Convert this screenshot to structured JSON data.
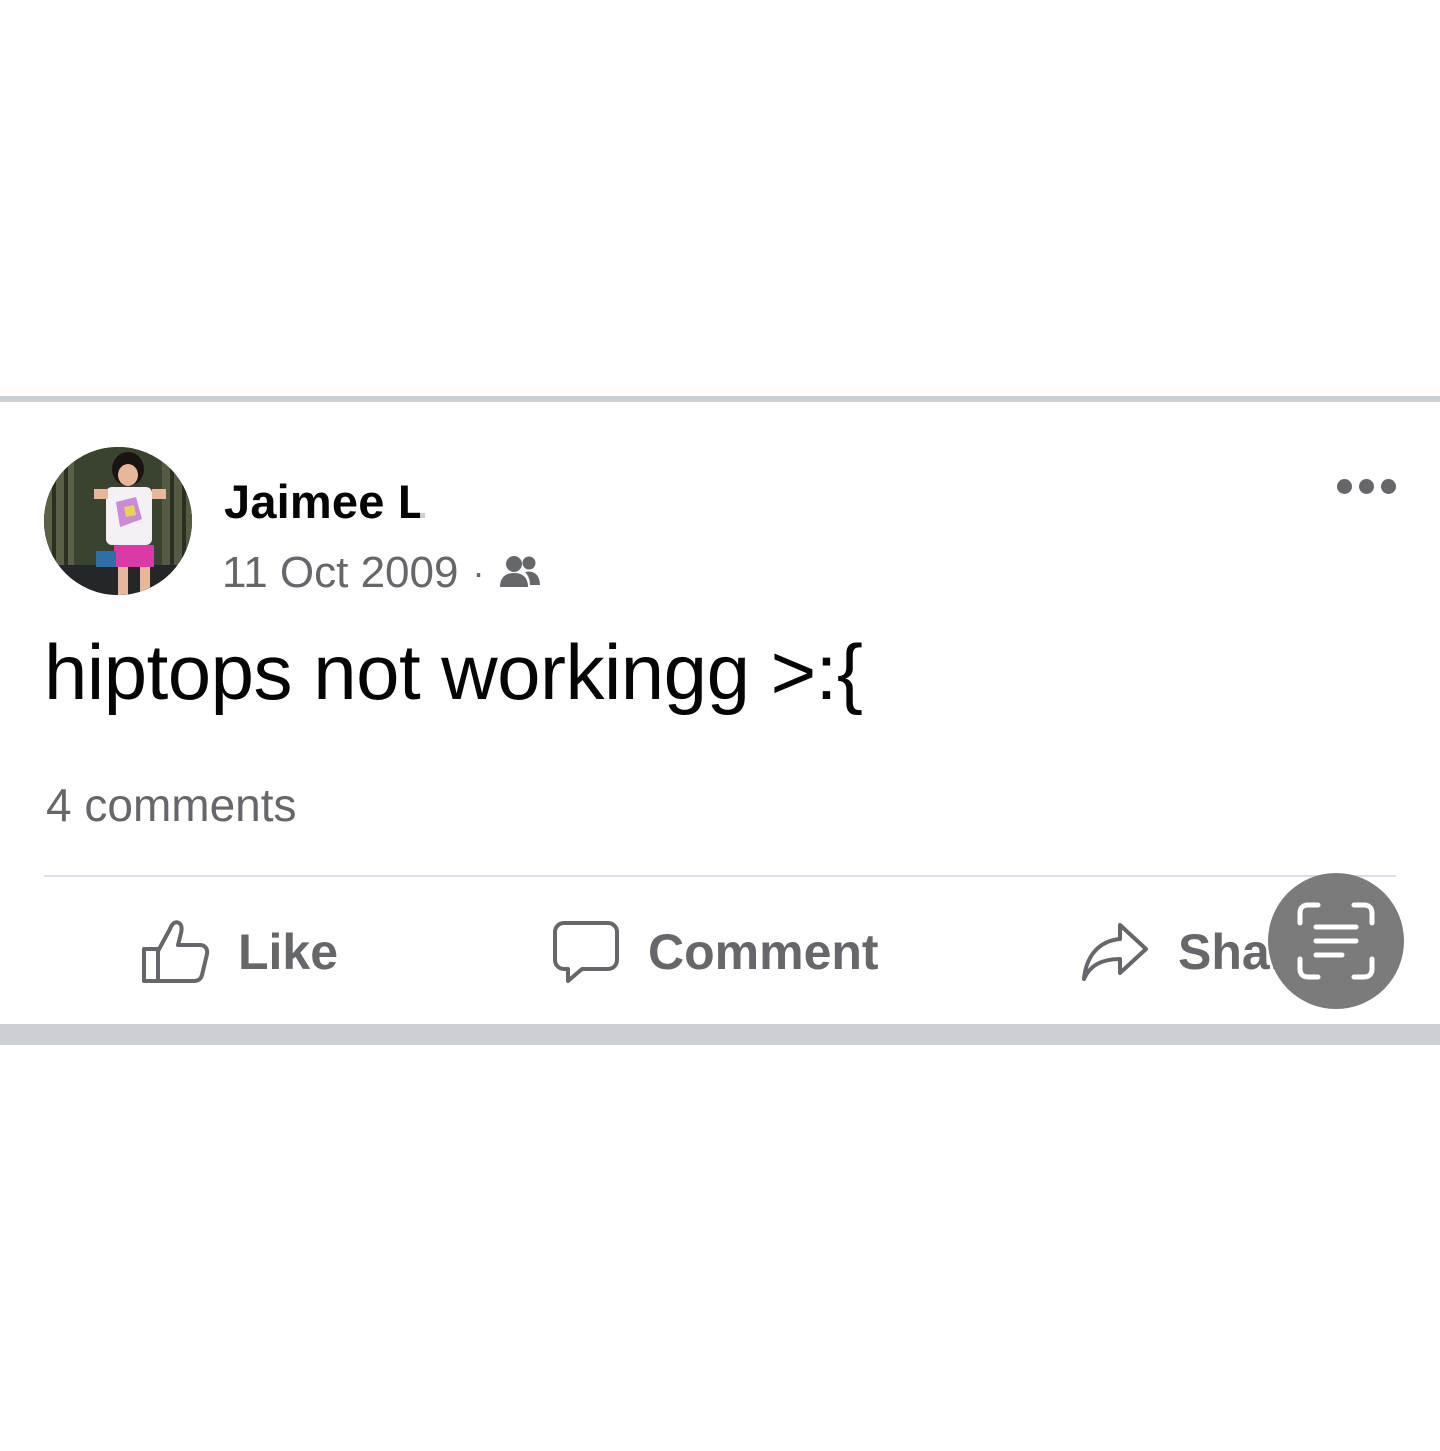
{
  "post": {
    "author_name": "Jaimee L",
    "date": "11 Oct 2009",
    "meta_separator": "·",
    "audience_icon": "friends-icon",
    "text": "hiptops not workingg >:{",
    "comment_count": "4 comments",
    "more_icon": "more-horizontal-icon"
  },
  "actions": {
    "like_label": "Like",
    "comment_label": "Comment",
    "share_label": "Share"
  },
  "overlay": {
    "scan_icon": "text-scan-icon"
  },
  "colors": {
    "primary_text": "#050505",
    "secondary_text": "#65676b",
    "divider": "#ccd0d5",
    "scan_button_bg": "#7b7b7b"
  }
}
